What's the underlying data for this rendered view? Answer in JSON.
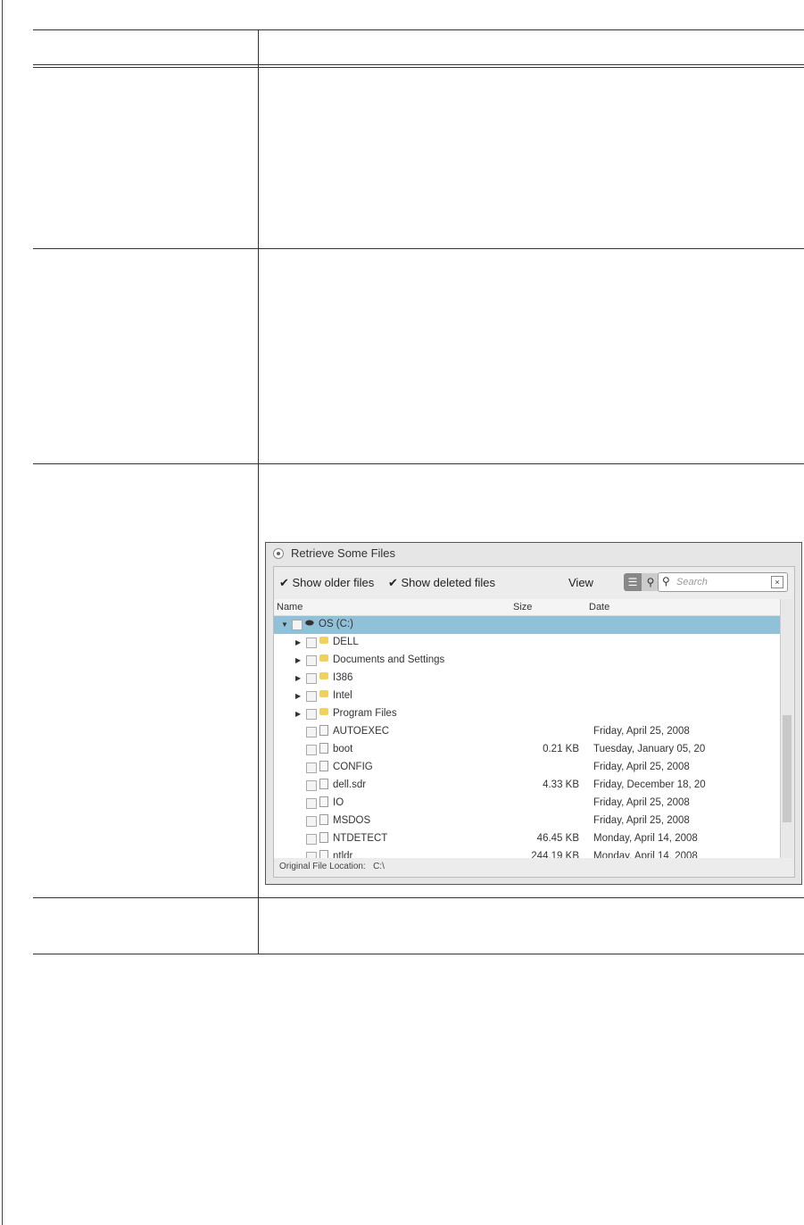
{
  "screenshot": {
    "option_label": "Retrieve Some Files",
    "show_older": "Show older files",
    "show_deleted": "Show deleted files",
    "view_label": "View",
    "search_placeholder": "Search",
    "columns": {
      "name": "Name",
      "size": "Size",
      "date": "Date"
    },
    "rows": [
      {
        "name": "OS (C:)",
        "size": "",
        "date": "",
        "type": "drive"
      },
      {
        "name": "DELL",
        "size": "",
        "date": "",
        "type": "folder"
      },
      {
        "name": "Documents and Settings",
        "size": "",
        "date": "",
        "type": "folder"
      },
      {
        "name": "I386",
        "size": "",
        "date": "",
        "type": "folder"
      },
      {
        "name": "Intel",
        "size": "",
        "date": "",
        "type": "folder"
      },
      {
        "name": "Program Files",
        "size": "",
        "date": "",
        "type": "folder"
      },
      {
        "name": "AUTOEXEC",
        "size": "",
        "date": "Friday, April 25, 2008",
        "type": "file"
      },
      {
        "name": "boot",
        "size": "0.21 KB",
        "date": "Tuesday, January 05, 20",
        "type": "file"
      },
      {
        "name": "CONFIG",
        "size": "",
        "date": "Friday, April 25, 2008",
        "type": "file"
      },
      {
        "name": "dell.sdr",
        "size": "4.33 KB",
        "date": "Friday, December 18, 20",
        "type": "file"
      },
      {
        "name": "IO",
        "size": "",
        "date": "Friday, April 25, 2008",
        "type": "file"
      },
      {
        "name": "MSDOS",
        "size": "",
        "date": "Friday, April 25, 2008",
        "type": "file"
      },
      {
        "name": "NTDETECT",
        "size": "46.45 KB",
        "date": "Monday, April 14, 2008",
        "type": "file"
      },
      {
        "name": "ntldr",
        "size": "244.19 KB",
        "date": "Monday, April 14, 2008",
        "type": "file"
      }
    ],
    "footer_label": "Original File Location:",
    "footer_value": "C:\\"
  }
}
